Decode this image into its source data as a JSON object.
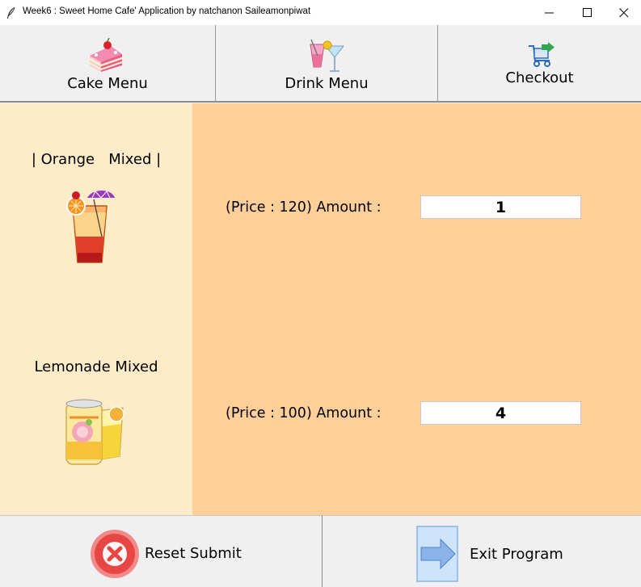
{
  "window": {
    "title": "Week6 : Sweet Home Cafe' Application by natchanon Saileamonpiwat"
  },
  "nav": {
    "cake_label": "Cake Menu",
    "drink_label": "Drink Menu",
    "checkout_label": "Checkout"
  },
  "items": [
    {
      "name": "| Orange   Mixed |",
      "price_label": "(Price : 120) Amount :",
      "amount": "1"
    },
    {
      "name": "Lemonade Mixed",
      "price_label": "(Price : 100) Amount :",
      "amount": "4"
    }
  ],
  "actions": {
    "reset_label": "Reset Submit",
    "exit_label": "Exit Program"
  },
  "colors": {
    "left_panel": "#feebc8",
    "right_panel": "#fecf99",
    "reset_red": "#e84545",
    "exit_blue": "#8ab4e8"
  }
}
